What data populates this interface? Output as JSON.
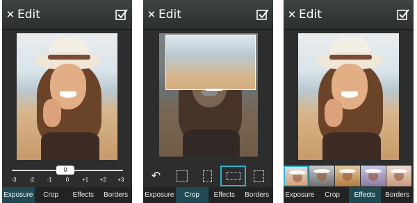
{
  "screens": [
    {
      "title": "Edit",
      "tabs": [
        "Exposure",
        "Crop",
        "Effects",
        "Borders"
      ],
      "active_tab": "Exposure",
      "exposure_slider": {
        "value": "0",
        "ticks": [
          "-3",
          "-2",
          "-1",
          "0",
          "+1",
          "+2",
          "+3"
        ]
      }
    },
    {
      "title": "Edit",
      "tabs": [
        "Exposure",
        "Crop",
        "Effects",
        "Borders"
      ],
      "active_tab": "Crop",
      "crop_tools": [
        "undo-icon",
        "crop-ratio-1",
        "crop-ratio-2",
        "crop-ratio-3",
        "crop-ratio-4"
      ]
    },
    {
      "title": "Edit",
      "tabs": [
        "Exposure",
        "Crop",
        "Effects",
        "Borders"
      ],
      "active_tab": "Effects",
      "effects": [
        "normal",
        "black-white",
        "sepia",
        "cool",
        "warm"
      ]
    }
  ],
  "colors": {
    "accent": "#2fb3d6",
    "active_tab": "#1f4a54",
    "background": "#2d2d2d"
  },
  "icons": {
    "close": "✕",
    "undo": "↶"
  }
}
